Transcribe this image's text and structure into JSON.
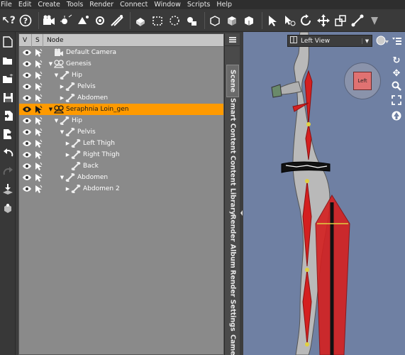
{
  "menu": [
    "File",
    "Edit",
    "Create",
    "Tools",
    "Render",
    "Connect",
    "Window",
    "Scripts",
    "Help"
  ],
  "scene": {
    "columns": {
      "v": "V",
      "s": "S",
      "node": "Node"
    },
    "rows": [
      {
        "label": "Default Camera",
        "depth": 0,
        "arrow": "",
        "icon": "camera-icon",
        "selected": false
      },
      {
        "label": "Genesis",
        "depth": 0,
        "arrow": "▼",
        "icon": "figure-icon",
        "selected": false
      },
      {
        "label": "Hip",
        "depth": 1,
        "arrow": "▼",
        "icon": "bone-icon",
        "selected": false
      },
      {
        "label": "Pelvis",
        "depth": 2,
        "arrow": "▶",
        "icon": "bone-icon",
        "selected": false
      },
      {
        "label": "Abdomen",
        "depth": 2,
        "arrow": "▶",
        "icon": "bone-icon",
        "selected": false
      },
      {
        "label": "Seraphnia Loin_gen",
        "depth": 0,
        "arrow": "▼",
        "icon": "figure-icon",
        "selected": true
      },
      {
        "label": "Hip",
        "depth": 1,
        "arrow": "▼",
        "icon": "bone-icon",
        "selected": false
      },
      {
        "label": "Pelvis",
        "depth": 2,
        "arrow": "▼",
        "icon": "bone-icon",
        "selected": false
      },
      {
        "label": "Left Thigh",
        "depth": 3,
        "arrow": "▶",
        "icon": "bone-icon",
        "selected": false
      },
      {
        "label": "Right Thigh",
        "depth": 3,
        "arrow": "▶",
        "icon": "bone-icon",
        "selected": false
      },
      {
        "label": "Back",
        "depth": 3,
        "arrow": "",
        "icon": "bone-icon",
        "selected": false
      },
      {
        "label": "Abdomen",
        "depth": 2,
        "arrow": "▼",
        "icon": "bone-icon",
        "selected": false
      },
      {
        "label": "Abdomen 2",
        "depth": 3,
        "arrow": "▶",
        "icon": "bone-icon",
        "selected": false
      }
    ]
  },
  "tabs": [
    "Scene",
    "Smart Content",
    "Content Library",
    "Render Album",
    "Render Settings",
    "Came"
  ],
  "viewport": {
    "view_label": "Left View",
    "cube_label": "Left"
  },
  "colors": {
    "accent": "#ff9a00",
    "viewport_bg": "#6f80a3",
    "bone_red": "#d42020"
  }
}
